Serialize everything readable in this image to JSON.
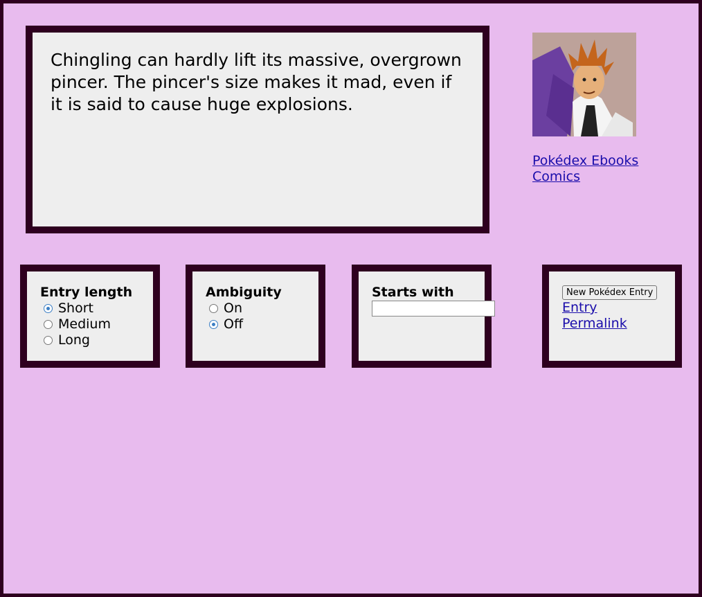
{
  "entry": {
    "text": "Chingling can hardly lift its massive, overgrown pincer. The pincer's size makes it mad, even if it is said to cause huge explosions."
  },
  "sidebar": {
    "links": [
      "Pokédex Ebooks",
      "Comics"
    ]
  },
  "options": {
    "entry_length": {
      "title": "Entry length",
      "options": [
        "Short",
        "Medium",
        "Long"
      ],
      "selected": "Short"
    },
    "ambiguity": {
      "title": "Ambiguity",
      "options": [
        "On",
        "Off"
      ],
      "selected": "Off"
    },
    "starts_with": {
      "title": "Starts with",
      "value": ""
    },
    "actions": {
      "button_label": "New Pokédex Entry",
      "links": [
        "Entry",
        "Permalink"
      ]
    }
  },
  "colors": {
    "background": "#e8bbee",
    "border": "#2e001f",
    "panel": "#eeeeee",
    "link": "#1a0dab",
    "radio_accent": "#3b7ec4"
  }
}
